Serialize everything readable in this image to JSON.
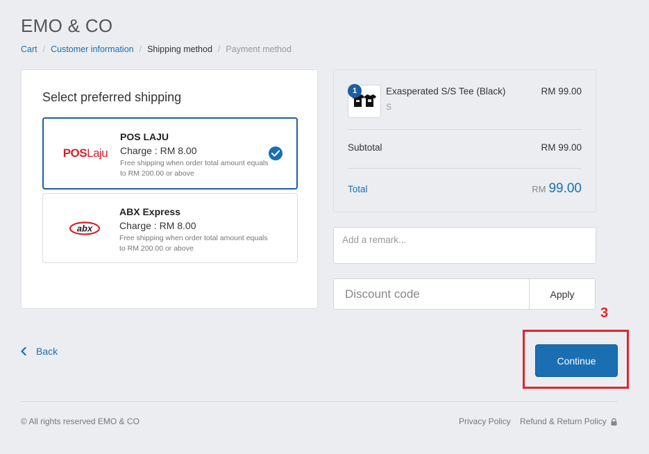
{
  "header": {
    "brand": "EMO & CO"
  },
  "breadcrumb": [
    {
      "label": "Cart",
      "state": "link"
    },
    {
      "label": "Customer information",
      "state": "link"
    },
    {
      "label": "Shipping method",
      "state": "current"
    },
    {
      "label": "Payment method",
      "state": "upcoming"
    }
  ],
  "shipping": {
    "title": "Select preferred shipping",
    "options": [
      {
        "name": "POS LAJU",
        "charge": "Charge : RM 8.00",
        "note": "Free shipping when order total amount equals to RM 200.00 or above",
        "logo": {
          "part1": "POS",
          "part2": "Laju"
        },
        "selected": true
      },
      {
        "name": "ABX Express",
        "charge": "Charge : RM 8.00",
        "note": "Free shipping when order total amount equals to RM 200.00 or above",
        "logo": {
          "text": "abx"
        },
        "selected": false
      }
    ]
  },
  "order": {
    "item": {
      "quantity": "1",
      "name": "Exasperated S/S Tee (Black)",
      "variant": "S",
      "price": "RM 99.00"
    },
    "subtotal_label": "Subtotal",
    "subtotal_value": "RM 99.00",
    "total_label": "Total",
    "total_currency": "RM",
    "total_amount": "99.00"
  },
  "remark": {
    "placeholder": "Add a remark..."
  },
  "discount": {
    "placeholder": "Discount code",
    "apply_label": "Apply"
  },
  "annotation": {
    "step": "3"
  },
  "actions": {
    "continue_label": "Continue",
    "back_label": "Back"
  },
  "footer": {
    "copyright": "© All rights reserved EMO & CO",
    "privacy": "Privacy Policy",
    "refund": "Refund & Return Policy"
  },
  "colors": {
    "accent": "#1a6fb3",
    "annotation": "#e0242c",
    "pos_laju_brand": "#d8202a"
  }
}
